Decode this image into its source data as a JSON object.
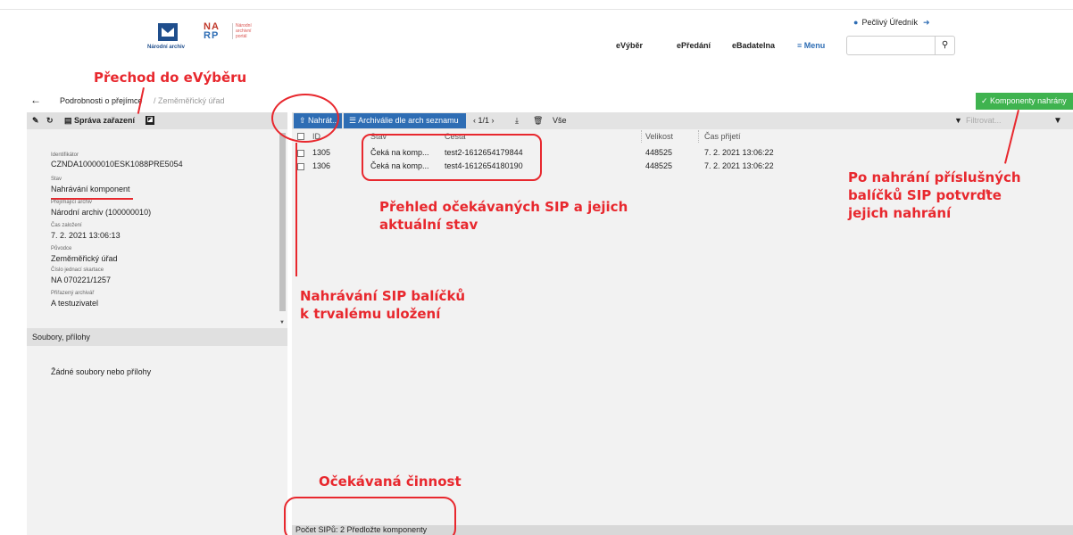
{
  "header": {
    "logo_na_text": "Národní archiv",
    "logo_narp_letters": "NARP",
    "logo_narp_side": [
      "Národní",
      "archivní",
      "portál"
    ],
    "user_name": "Pečlivý Úředník",
    "nav": [
      "eVýběr",
      "ePředání",
      "eBadatelna",
      "≡ Menu"
    ],
    "search_placeholder": ""
  },
  "breadcrumb": {
    "back": "←",
    "item1": "Podrobnosti o přejímce",
    "separator": "/",
    "item2": "Zeměměřický úřad"
  },
  "confirm_button": "✓ Komponenty nahrány",
  "left_toolbar": {
    "edit_icon": "✎",
    "history_icon": "↻",
    "manage_label": "Správa zařazení",
    "nav_icon": "◪"
  },
  "details": [
    {
      "label": "Identifikátor",
      "value": "CZNDA10000010ESK1088PRE5054"
    },
    {
      "label": "Stav",
      "value": "Nahrávání komponent"
    },
    {
      "label": "Přejímající archiv",
      "value": "Národní archiv (100000010)"
    },
    {
      "label": "Čas založení",
      "value": "7. 2. 2021 13:06:13"
    },
    {
      "label": "Původce",
      "value": "Zeměměřický úřad"
    },
    {
      "label": "Číslo jednací skartace",
      "value": "NA 070221/1257"
    },
    {
      "label": "Přiřazený archivář",
      "value": "A testuzivatel"
    }
  ],
  "files": {
    "header": "Soubory, přílohy",
    "empty": "Žádné soubory nebo přílohy"
  },
  "toolbar": {
    "upload": "Nahrát...",
    "by_list": "Archiválie dle arch seznamu",
    "pager": "‹  1/1  ›",
    "filter_select": "Vše",
    "filter_placeholder": "Filtrovat..."
  },
  "table": {
    "headers": [
      "ID",
      "Stav",
      "Cesta",
      "Velikost",
      "Čas přijetí"
    ],
    "rows": [
      {
        "id": "1305",
        "stav": "Čeká na komp...",
        "cesta": "test2-1612654179844",
        "velikost": "448525",
        "cas": "7. 2. 2021 13:06:22"
      },
      {
        "id": "1306",
        "stav": "Čeká na komp...",
        "cesta": "test4-1612654180190",
        "velikost": "448525",
        "cas": "7. 2. 2021 13:06:22"
      }
    ]
  },
  "status_bar": "Počet SIPů: 2    Předložte komponenty",
  "annotations": {
    "evyber": "Přechod do eVýběru",
    "prehled": "Přehled očekávaných SIP a jejich aktuální stav",
    "nahravani": "Nahrávání SIP balíčků k trvalému uložení",
    "potvrzeni": "Po nahrání příslušných balíčků SIP potvrďte jejich nahrání",
    "cinnost": "Očekávaná činnost"
  },
  "colors": {
    "accent_blue": "#2e6db4",
    "confirm_green": "#3fb34f",
    "annotation_red": "#e8282e"
  }
}
